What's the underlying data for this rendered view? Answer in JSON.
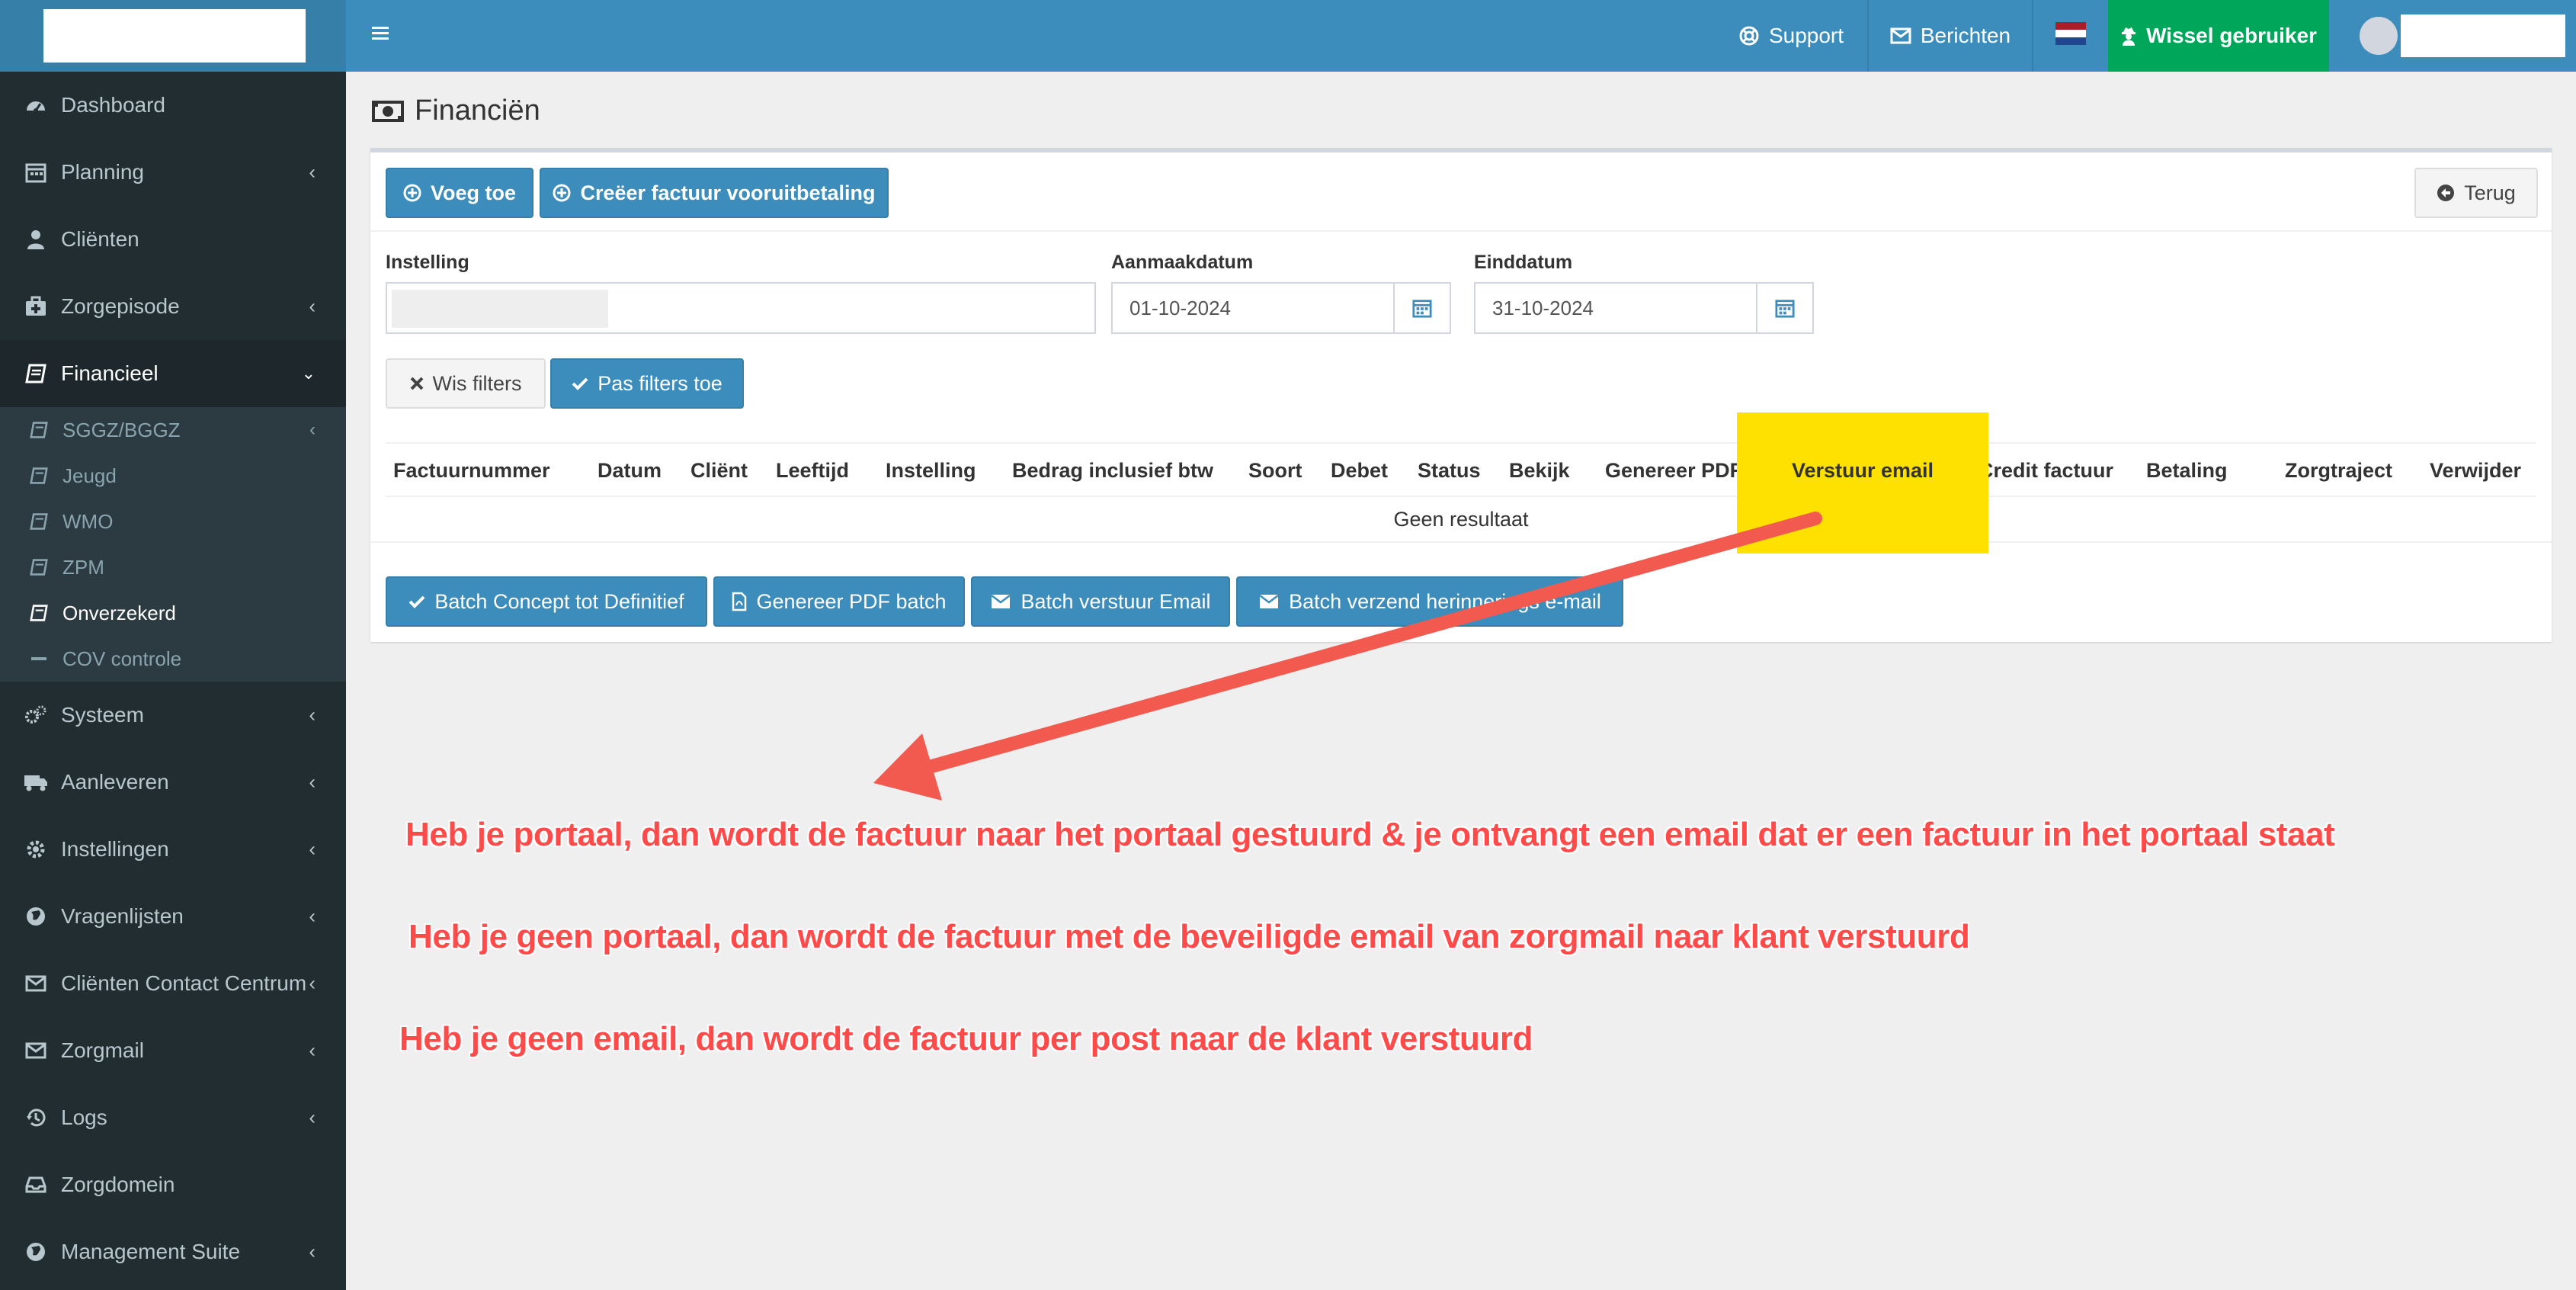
{
  "sidebar": {
    "items_top": [
      {
        "label": "Dashboard",
        "icon": "dashboard-icon",
        "chevron": false
      },
      {
        "label": "Planning",
        "icon": "calendar-icon",
        "chevron": true
      },
      {
        "label": "Cliënten",
        "icon": "user-icon",
        "chevron": false
      },
      {
        "label": "Zorgepisode",
        "icon": "medkit-icon",
        "chevron": true
      },
      {
        "label": "Financieel",
        "icon": "book-icon",
        "chevron": true,
        "expanded": true
      }
    ],
    "subitems": [
      {
        "label": "SGGZ/BGGZ",
        "icon": "book-icon",
        "chevron": true
      },
      {
        "label": "Jeugd",
        "icon": "book-icon"
      },
      {
        "label": "WMO",
        "icon": "book-icon"
      },
      {
        "label": "ZPM",
        "icon": "book-icon"
      },
      {
        "label": "Onverzekerd",
        "icon": "book-icon",
        "current": true
      },
      {
        "label": "COV controle",
        "icon": "minus-icon"
      }
    ],
    "items_bottom": [
      {
        "label": "Systeem",
        "icon": "cogs-icon",
        "chevron": true
      },
      {
        "label": "Aanleveren",
        "icon": "truck-icon",
        "chevron": true
      },
      {
        "label": "Instellingen",
        "icon": "gear-icon",
        "chevron": true
      },
      {
        "label": "Vragenlijsten",
        "icon": "globe-icon",
        "chevron": true
      },
      {
        "label": "Cliënten Contact Centrum",
        "icon": "envelope-icon",
        "chevron": true
      },
      {
        "label": "Zorgmail",
        "icon": "envelope-icon",
        "chevron": true
      },
      {
        "label": "Logs",
        "icon": "history-icon",
        "chevron": true
      },
      {
        "label": "Zorgdomein",
        "icon": "inbox-icon",
        "chevron": false
      },
      {
        "label": "Management Suite",
        "icon": "globe-icon",
        "chevron": true
      }
    ]
  },
  "topbar": {
    "support": "Support",
    "berichten": "Berichten",
    "wissel": "Wissel gebruiker",
    "flag_colors": [
      "#ae1c28",
      "#ffffff",
      "#21468b"
    ]
  },
  "page": {
    "title": "Financiën"
  },
  "toolbar": {
    "add": "Voeg toe",
    "create_invoice": "Creëer factuur vooruitbetaling",
    "back": "Terug"
  },
  "filters": {
    "instelling_label": "Instelling",
    "aanmaakdatum_label": "Aanmaakdatum",
    "aanmaakdatum_value": "01-10-2024",
    "einddatum_label": "Einddatum",
    "einddatum_value": "31-10-2024",
    "clear": "Wis filters",
    "apply": "Pas filters toe"
  },
  "table": {
    "columns": [
      "Factuurnummer",
      "Datum",
      "Cliënt",
      "Leeftijd",
      "Instelling",
      "Bedrag inclusief btw",
      "Soort",
      "Debet",
      "Status",
      "Bekijk",
      "Genereer PDF",
      "Verstuur email",
      "Credit factuur",
      "Betaling",
      "Zorgtraject",
      "Verwijder"
    ],
    "empty": "Geen resultaat"
  },
  "batch": {
    "concept": "Batch Concept tot Definitief",
    "pdf": "Genereer PDF batch",
    "email": "Batch verstuur Email",
    "reminder": "Batch verzend herinnerings e-mail"
  },
  "annotations": {
    "highlight_color": "#ffe100",
    "arrow_color": "#f25a4f",
    "text_color": "#ff4a4a",
    "line1": "Heb je portaal, dan wordt de factuur naar het portaal gestuurd & je ontvangt een email dat er een factuur in het portaal staat",
    "line2": "Heb je geen portaal, dan wordt de factuur met de beveiligde email van zorgmail naar klant verstuurd",
    "line3": "Heb je geen email, dan wordt de factuur per post naar de klant verstuurd"
  }
}
